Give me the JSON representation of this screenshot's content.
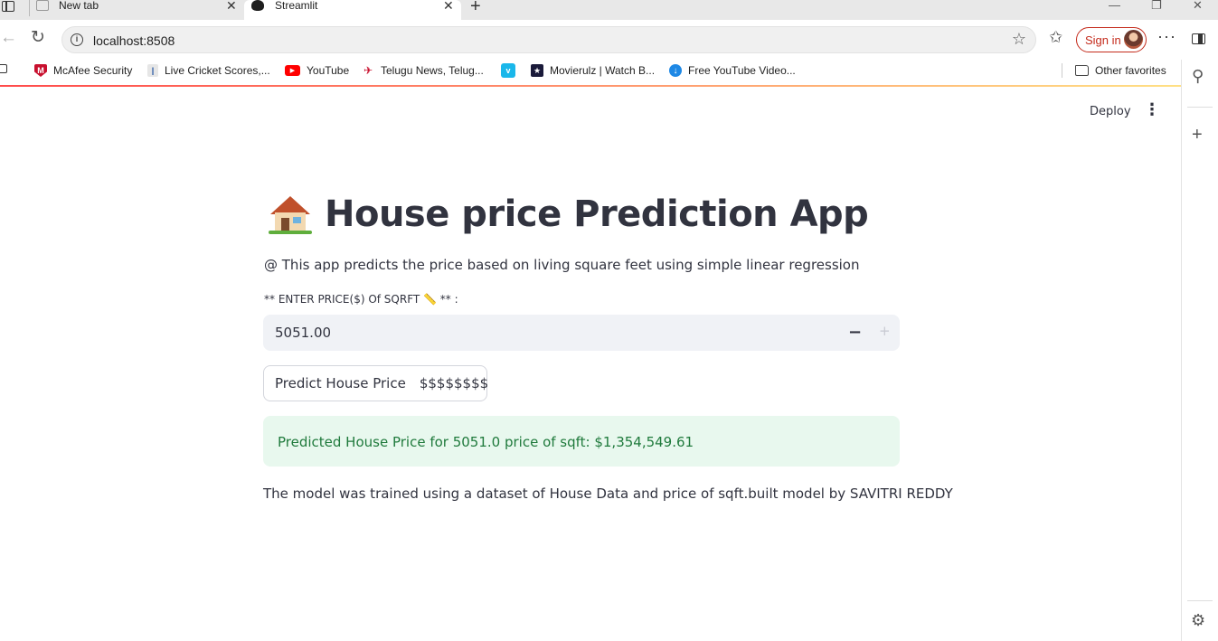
{
  "browser": {
    "tabs": [
      {
        "title": "New tab",
        "active": false
      },
      {
        "title": "Streamlit",
        "active": true
      }
    ],
    "address": "localhost:8508",
    "sign_in_label": "Sign in",
    "favorites": [
      {
        "label": "McAfee Security",
        "icon": "mcafee-shield-icon"
      },
      {
        "label": "Live Cricket Scores,...",
        "icon": "cricket-icon"
      },
      {
        "label": "YouTube",
        "icon": "youtube-icon"
      },
      {
        "label": "Telugu News, Telug...",
        "icon": "news-icon"
      },
      {
        "label": "",
        "icon": "vimeo-icon"
      },
      {
        "label": "Movierulz | Watch B...",
        "icon": "movie-icon"
      },
      {
        "label": "Free YouTube Video...",
        "icon": "download-icon"
      }
    ],
    "other_favorites": "Other favorites"
  },
  "app": {
    "deploy_label": "Deploy",
    "title": "House price Prediction App",
    "subtitle": "@ This app predicts the price based on living square feet using simple linear regression",
    "input_label": "** ENTER PRICE($) Of SQRFT 📏 ** :",
    "input_value": "5051.00",
    "button_label_left": "Predict House Price",
    "button_label_right": "$$$$$$$$",
    "result_text": "Predicted House Price for 5051.0 price of sqft: $1,354,549.61",
    "footer_text": "The model was trained using a dataset of House Data and price of sqft.built model by SAVITRI REDDY"
  },
  "colors": {
    "accent_red": "#ff4b4b",
    "success_bg": "#e8f8ee",
    "success_text": "#1f7a3c",
    "signin_red": "#c42b1c"
  }
}
